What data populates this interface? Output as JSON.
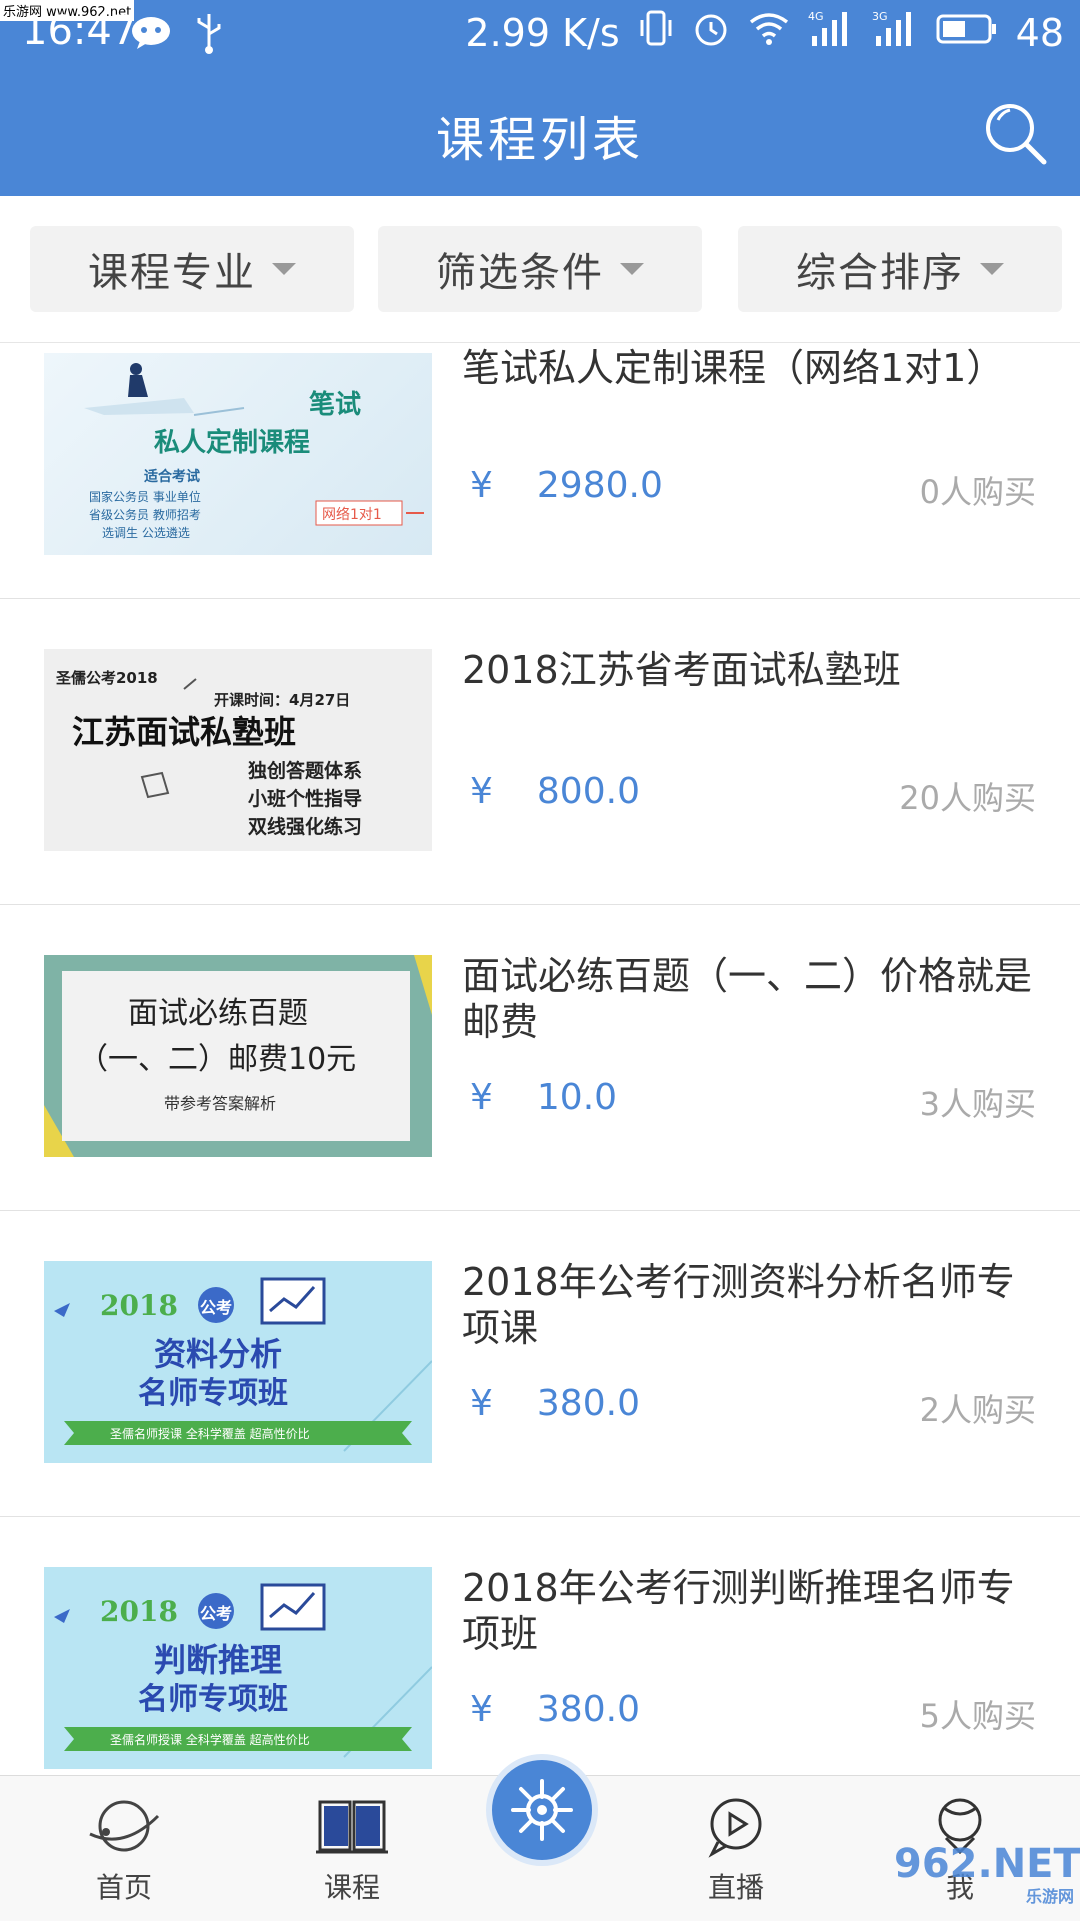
{
  "watermark_top": "乐游网 www.962.net",
  "status_bar": {
    "time": "16:47",
    "speed": "2.99 K/s",
    "net1": "4G",
    "net2": "3G",
    "battery": "48"
  },
  "header": {
    "title": "课程列表",
    "search_icon": "search-icon"
  },
  "filters": [
    {
      "label": "课程专业"
    },
    {
      "label": "筛选条件"
    },
    {
      "label": "综合排序"
    }
  ],
  "courses": [
    {
      "title": "笔试私人定制课程（网络1对1）",
      "yen": "¥",
      "price": "2980.0",
      "buyers": "0人购买",
      "thumb": {
        "l1": "笔试",
        "l2": "私人定制课程",
        "l3": "适合考试",
        "l4": "国家公务员   事业单位",
        "l5": "省级公务员   教师招考",
        "l6": "选调生      公选遴选",
        "badge": "网络1对1"
      }
    },
    {
      "title": "2018江苏省考面试私塾班",
      "yen": "¥",
      "price": "800.0",
      "buyers": "20人购买",
      "thumb": {
        "l1": "圣儒公考2018",
        "l2": "开课时间：4月27日",
        "l3": "江苏面试私塾班",
        "l4": "独创答题体系",
        "l5": "小班个性指导",
        "l6": "双线强化练习"
      }
    },
    {
      "title": "面试必练百题（一、二）价格就是邮费",
      "yen": "¥",
      "price": "10.0",
      "buyers": "3人购买",
      "thumb": {
        "l1": "面试必练百题",
        "l2": "（一、二）邮费10元",
        "l3": "带参考答案解析"
      }
    },
    {
      "title": "2018年公考行测资料分析名师专项课",
      "yen": "¥",
      "price": "380.0",
      "buyers": "2人购买",
      "thumb": {
        "l1": "2018",
        "l2": "公考",
        "l3": "资料分析",
        "l4": "名师专项班",
        "l5": "圣儒名师授课  全科学覆盖  超高性价比"
      }
    },
    {
      "title": "2018年公考行测判断推理名师专项班",
      "yen": "¥",
      "price": "380.0",
      "buyers": "5人购买",
      "thumb": {
        "l1": "2018",
        "l2": "公考",
        "l3": "判断推理",
        "l4": "名师专项班",
        "l5": "圣儒名师授课  全科学覆盖  超高性价比"
      }
    }
  ],
  "bottom_nav": [
    {
      "label": "首页",
      "icon": "planet-icon"
    },
    {
      "label": "课程",
      "icon": "book-icon"
    },
    {
      "label": "",
      "icon": "helm-icon"
    },
    {
      "label": "直播",
      "icon": "play-bubble-icon"
    },
    {
      "label": "我",
      "icon": "person-icon"
    }
  ],
  "watermark_bottom": "962.NET",
  "watermark_bottom_sub": "乐游网",
  "colors": {
    "primary": "#4a86d6",
    "price": "#4a86d6",
    "buyers": "#aaaaaa"
  }
}
